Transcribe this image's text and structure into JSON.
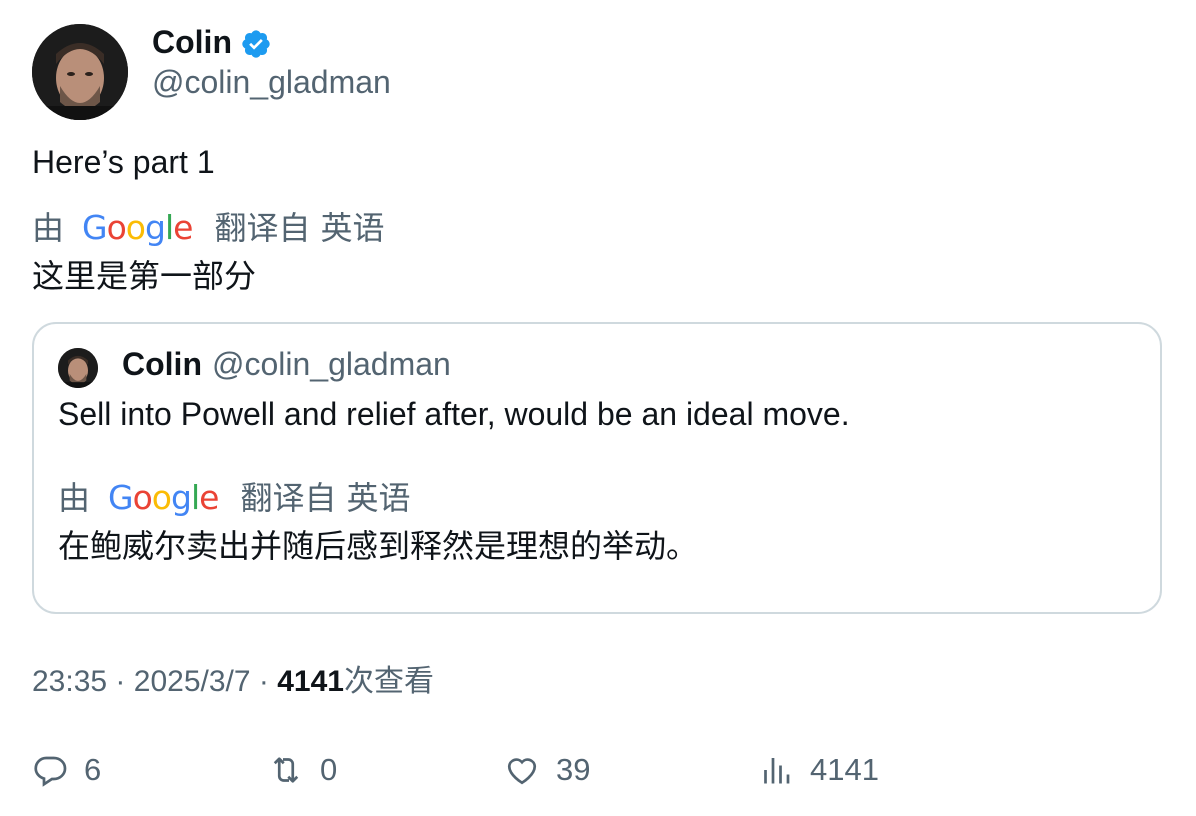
{
  "author": {
    "name": "Colin",
    "handle": "@colin_gladman"
  },
  "tweet": {
    "text": "Here’s part 1",
    "translation_label": {
      "by": "由",
      "provider": "Google",
      "translated_from": "翻译自",
      "language": "英语"
    },
    "translated_text": "这里是第一部分"
  },
  "quoted": {
    "name": "Colin",
    "handle": "@colin_gladman",
    "text": "Sell into Powell and relief after, would be an ideal move.",
    "translation_label": {
      "by": "由",
      "provider": "Google",
      "translated_from": "翻译自",
      "language": "英语"
    },
    "translated_text": "在鲍威尔卖出并随后感到释然是理想的举动。"
  },
  "meta": {
    "time": "23:35",
    "separator": "·",
    "date": "2025/3/7",
    "views_count": "4141",
    "views_label": "次查看"
  },
  "actions": {
    "replies": "6",
    "retweets": "0",
    "likes": "39",
    "views": "4141"
  },
  "colors": {
    "verified": "#1d9bf0",
    "secondary_text": "#536471",
    "border": "#cfd9de"
  }
}
